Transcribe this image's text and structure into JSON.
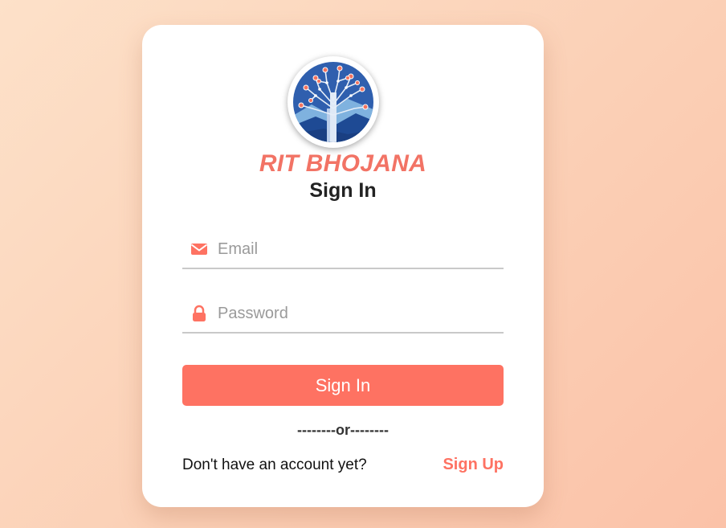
{
  "brand": {
    "name": "RIT BHOJANA",
    "logo_icon": "tree-circuit-logo-icon"
  },
  "form": {
    "title": "Sign In",
    "email": {
      "placeholder": "Email",
      "value": "",
      "icon": "envelope-icon"
    },
    "password": {
      "placeholder": "Password",
      "value": "",
      "icon": "lock-icon"
    },
    "submit_label": "Sign In",
    "divider_text": "--------or--------"
  },
  "footer": {
    "prompt_text": "Don't have an account yet?",
    "signup_label": "Sign Up"
  },
  "colors": {
    "accent": "#fe7262",
    "brand_text": "#f27365",
    "background_start": "#fde1c9",
    "background_end": "#fbc2a8"
  }
}
